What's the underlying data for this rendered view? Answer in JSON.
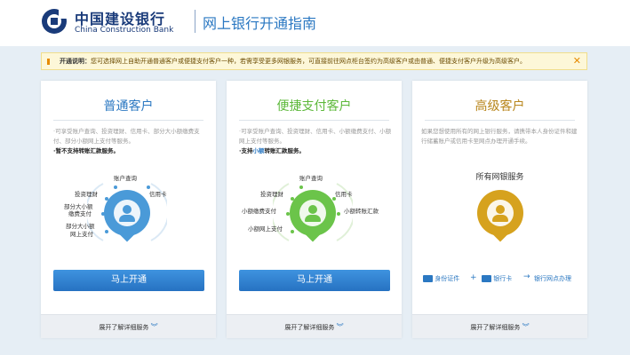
{
  "header": {
    "bank_name_cn": "中国建设银行",
    "bank_name_en": "China Construction Bank",
    "page_title": "网上银行开通指南"
  },
  "notice": {
    "label": "开通说明：",
    "text": "您可选择网上自助开通普通客户或便捷支付客户一种，若需享受更多网银服务，可直接前往网点柜台签约为高级客户或由普通、便捷支付客户升级为高级客户。",
    "close": "✕"
  },
  "cards": [
    {
      "title": "普通客户",
      "title_color": "#2b78c2",
      "desc_lead": "·可享受账户查询、投资理财、信用卡、部分大小额缴费支付、部分小额网上支付等服务。",
      "desc_bold": "·暂不支持转账汇款服务。",
      "services": [
        "账户查询",
        "投资理财",
        "信用卡",
        "部分大小额",
        "缴费支付",
        "部分大小额",
        "网上支付"
      ],
      "accent": "#4a9ad8",
      "button": "马上开通",
      "footer": "展开了解详细服务",
      "chev": "︾"
    },
    {
      "title": "便捷支付客户",
      "title_color": "#5cb83a",
      "desc_lead": "·可享受账户查询、投资理财、信用卡、小额缴费支付、小额网上支付等服务。",
      "desc_support_pre": "·支持",
      "desc_support_blue": "小额",
      "desc_support_post": "转账汇款服务。",
      "services": [
        "账户查询",
        "投资理财",
        "信用卡",
        "小额缴费支付",
        "小额转账汇款",
        "小额网上支付"
      ],
      "accent": "#6bc44a",
      "button": "马上开通",
      "footer": "展开了解详细服务",
      "chev": "︾"
    },
    {
      "title": "高级客户",
      "title_color": "#b8861c",
      "desc": "如果您想使用所有的网上银行服务，请携带本人身份证件和建行储蓄账户或信用卡至网点办理开通手续。",
      "all_services": "所有网银服务",
      "accent": "#d6a21e",
      "flow": [
        "身份证件",
        "+",
        "银行卡",
        "→",
        "银行网点办理"
      ],
      "footer": "展开了解详细服务",
      "chev": "︾"
    }
  ]
}
